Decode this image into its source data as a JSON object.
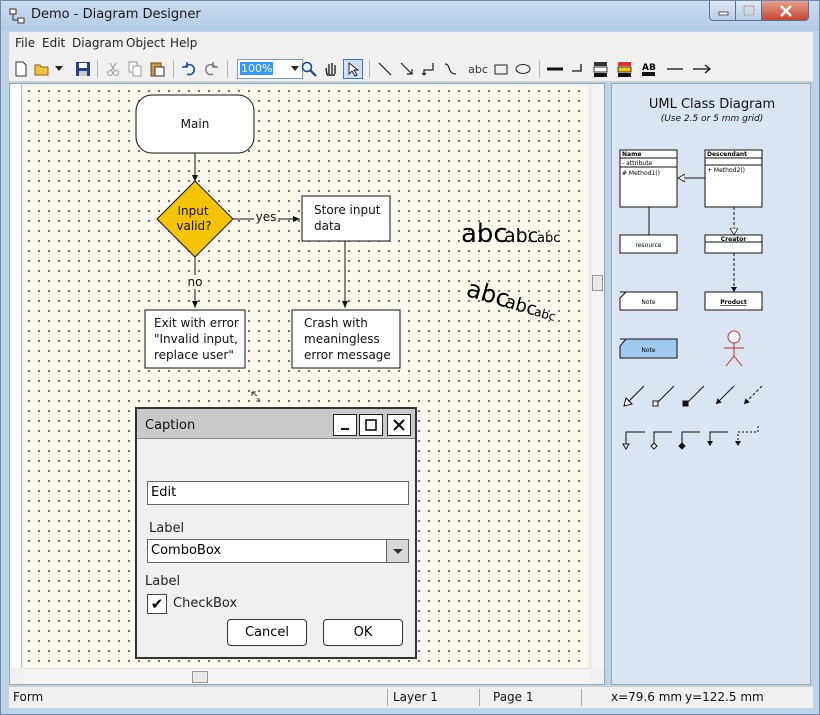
{
  "window": {
    "title": "Demo - Diagram Designer"
  },
  "menu": [
    "File",
    "Edit",
    "Diagram",
    "Object",
    "Help"
  ],
  "toolbar": {
    "zoom": "100%",
    "text_tool": "abc"
  },
  "diagram": {
    "start": "Main",
    "decision": [
      "Input",
      "valid?"
    ],
    "yes_label": "yes",
    "no_label": "no",
    "store": [
      "Store input",
      "data"
    ],
    "exit": [
      "Exit with error",
      "\"Invalid input,",
      "replace user\""
    ],
    "crash": [
      "Crash with",
      "meaningless",
      "error message"
    ],
    "sample_text": [
      "abc",
      "abc",
      "abc"
    ]
  },
  "dialog": {
    "caption": "Caption",
    "edit_value": "Edit",
    "label1": "Label",
    "combo_value": "ComboBox",
    "label2": "Label",
    "checkbox_label": "CheckBox",
    "checkbox_glyph": "✔",
    "cancel": "Cancel",
    "ok": "OK"
  },
  "palette": {
    "title": "UML Class Diagram",
    "subtitle": "(Use 2.5 or 5 mm grid)",
    "class1": {
      "name": "Name",
      "attr": "- attribute",
      "method": "# Method1()"
    },
    "class2": {
      "name": "Descendant",
      "method": "+ Method2()"
    },
    "resource": "resource",
    "creator": "Creator",
    "note1": "Note",
    "product": "Product",
    "note2": "Note"
  },
  "status": {
    "mode": "Form",
    "layer": "Layer 1",
    "page": "Page 1",
    "x": "x=79.6 mm",
    "y": "y=122.5 mm"
  },
  "colors": {
    "decision_fill": "#f5c400",
    "accent": "#3399ff"
  }
}
